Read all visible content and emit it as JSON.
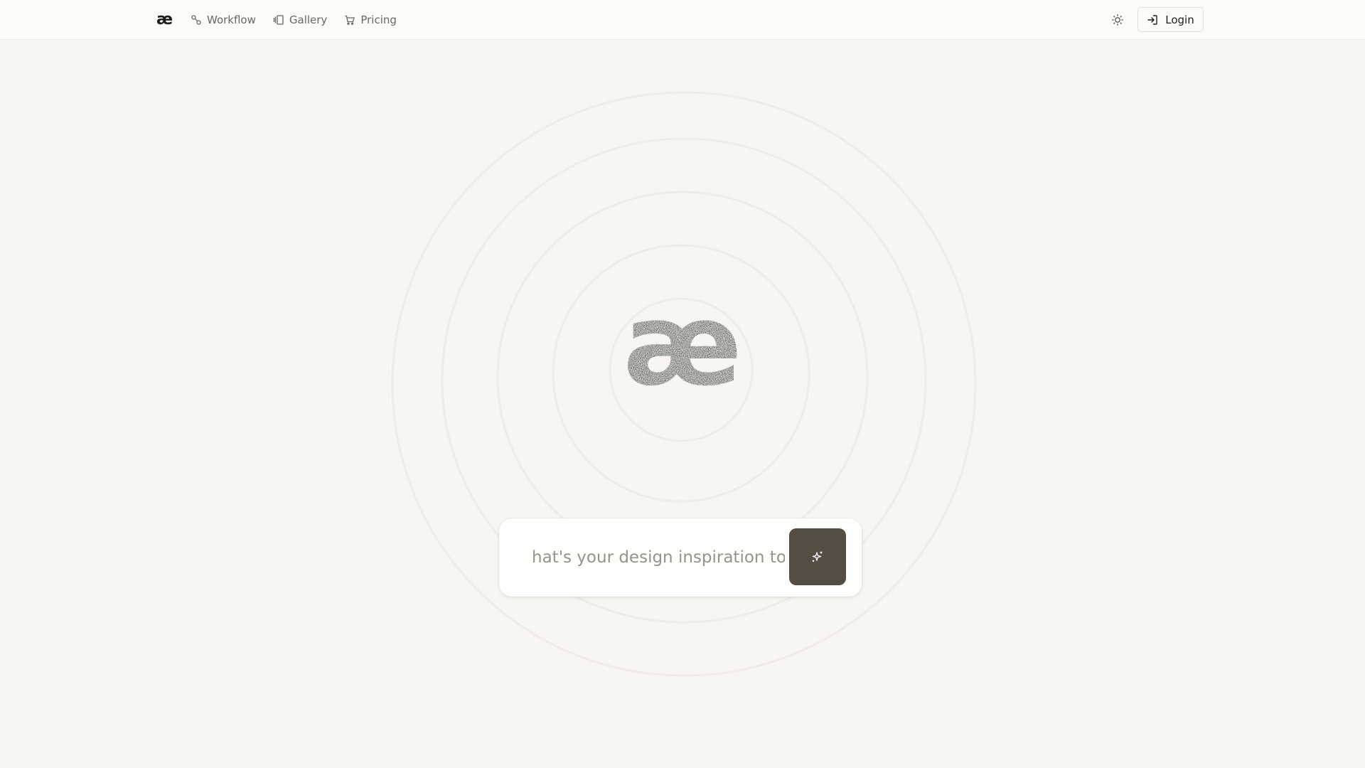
{
  "nav": {
    "logo": "æ",
    "links": [
      {
        "label": "Workflow",
        "icon": "workflow-icon"
      },
      {
        "label": "Gallery",
        "icon": "gallery-icon"
      },
      {
        "label": "Pricing",
        "icon": "cart-icon"
      }
    ],
    "theme_icon": "sun-icon",
    "login_label": "Login",
    "login_icon": "login-icon"
  },
  "hero": {
    "logo_glyph": "æ"
  },
  "prompt": {
    "placeholder": "hat's your design inspiration tod",
    "submit_icon": "sparkle-icon"
  },
  "colors": {
    "background": "#f7f6f2",
    "navbar": "#fbfbf8",
    "accent_button": "#534d43",
    "text_muted": "#6a6760"
  }
}
